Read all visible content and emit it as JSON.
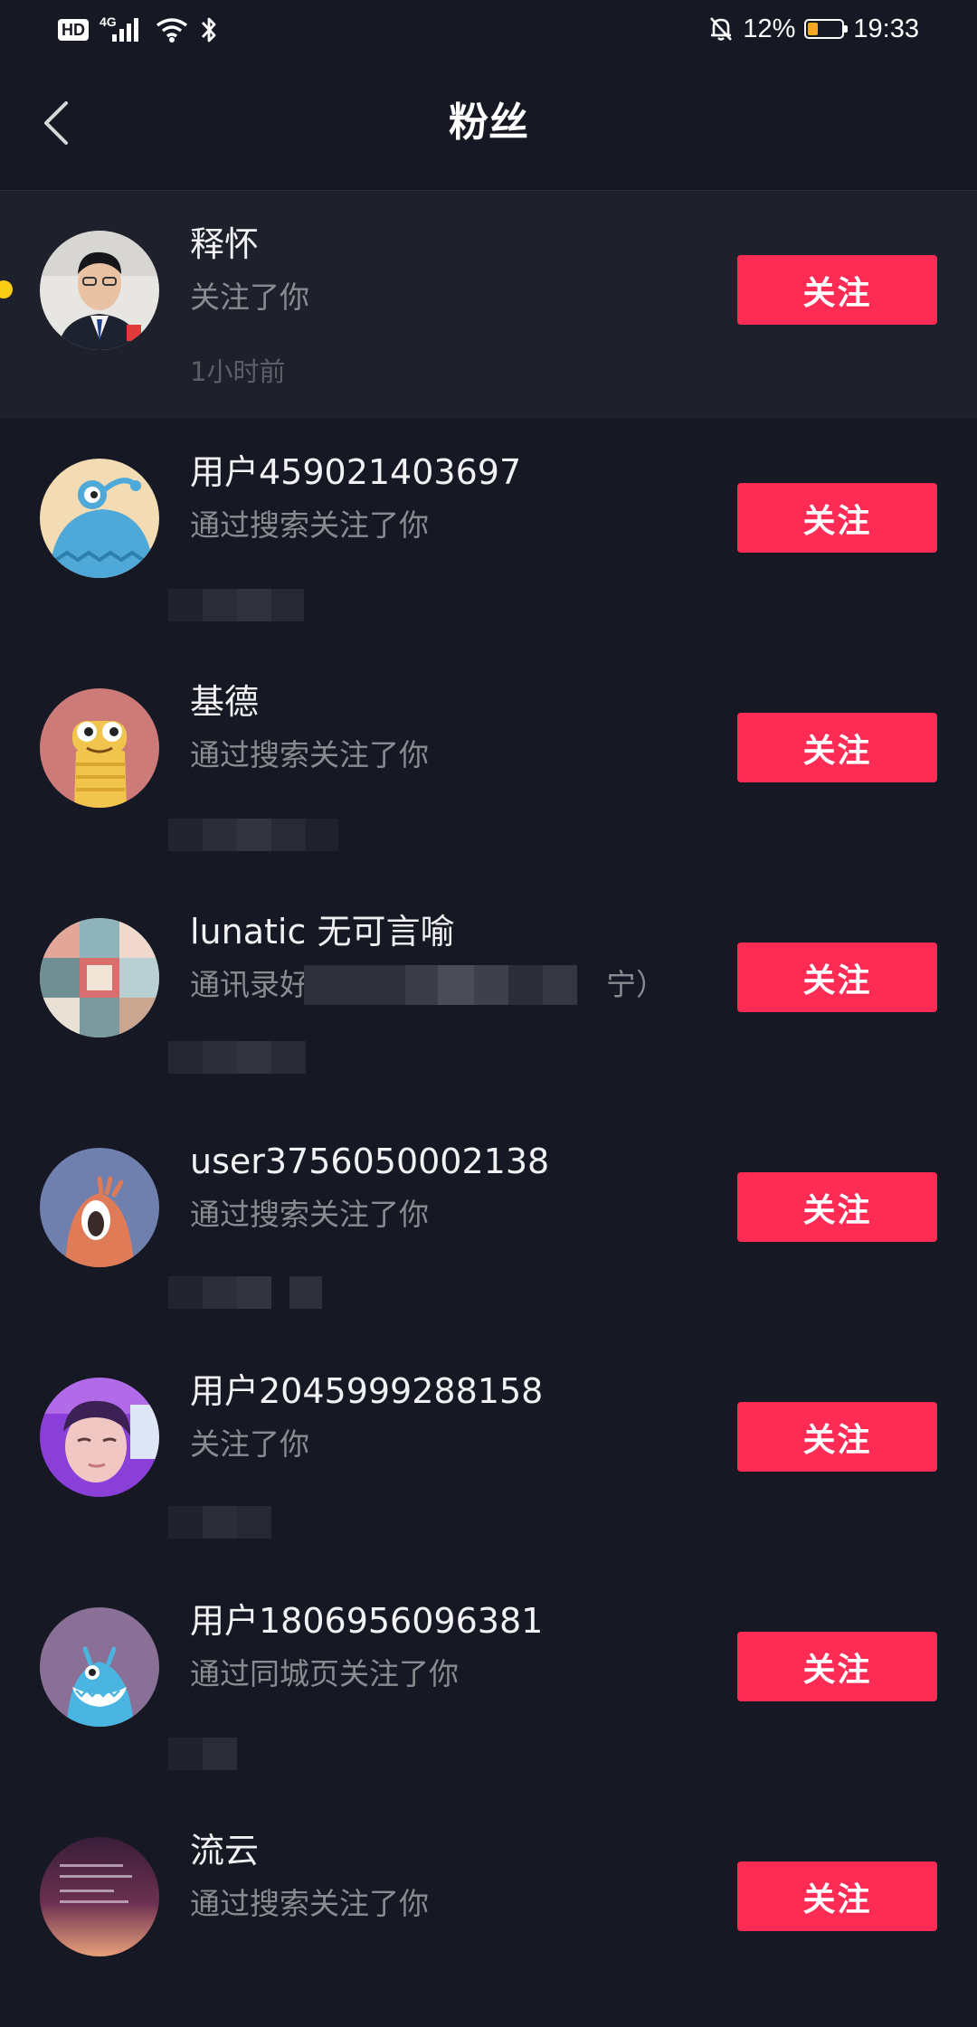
{
  "status_bar": {
    "hd": "HD",
    "network": "4G",
    "battery_text": "12%",
    "battery_level": 0.12,
    "time": "19:33"
  },
  "header": {
    "title": "粉丝"
  },
  "colors": {
    "background": "#161823",
    "unread_row": "#1e202b",
    "follow_button": "#fe2c55",
    "unread_dot": "#facc15"
  },
  "fans": [
    {
      "name": "释怀",
      "reason": "关注了你",
      "time": "1小时前",
      "button": "关注",
      "avatar": "portrait-photo",
      "unread": true
    },
    {
      "name": "用户459021403697",
      "reason": "通过搜索关注了你",
      "button": "关注",
      "avatar": "blue-monster-avatar"
    },
    {
      "name": "基德",
      "reason": "通过搜索关注了你",
      "button": "关注",
      "avatar": "yellow-monster-avatar"
    },
    {
      "name": "lunatic 无可言喻",
      "reason": "通讯录好",
      "reason_tail": "宁）",
      "button": "关注",
      "avatar": "collage-photo"
    },
    {
      "name": "user3756050002138",
      "reason": "通过搜索关注了你",
      "button": "关注",
      "avatar": "orange-monster-avatar"
    },
    {
      "name": "用户2045999288158",
      "reason": "关注了你",
      "button": "关注",
      "avatar": "selfie-photo"
    },
    {
      "name": "用户1806956096381",
      "reason": "通过同城页关注了你",
      "button": "关注",
      "avatar": "teal-monster-avatar"
    },
    {
      "name": "流云",
      "reason": "通过搜索关注了你",
      "button": "关注",
      "avatar": "text-sunset-photo"
    }
  ]
}
